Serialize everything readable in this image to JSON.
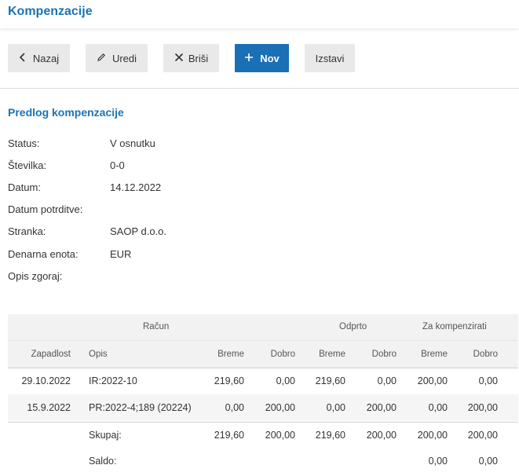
{
  "app": {
    "title": "Kompenzacije"
  },
  "toolbar": {
    "back_label": "Nazaj",
    "edit_label": "Uredi",
    "delete_label": "Briši",
    "new_label": "Nov",
    "issue_label": "Izstavi"
  },
  "section": {
    "title": "Predlog kompenzacije"
  },
  "fields": [
    {
      "label": "Status:",
      "value": "V osnutku"
    },
    {
      "label": "Številka:",
      "value": "0-0"
    },
    {
      "label": "Datum:",
      "value": "14.12.2022"
    },
    {
      "label": "Datum potrditve:",
      "value": ""
    },
    {
      "label": "Stranka:",
      "value": "SAOP d.o.o."
    },
    {
      "label": "Denarna enota:",
      "value": "EUR"
    },
    {
      "label": "Opis zgoraj:",
      "value": ""
    }
  ],
  "table": {
    "group_headers": {
      "racun": "Račun",
      "odprto": "Odprto",
      "za_kompenzirati": "Za kompenzirati"
    },
    "columns": {
      "zapadlost": "Zapadlost",
      "opis": "Opis",
      "breme1": "Breme",
      "dobro1": "Dobro",
      "breme2": "Breme",
      "dobro2": "Dobro",
      "breme3": "Breme",
      "dobro3": "Dobro"
    },
    "rows": [
      {
        "zapadlost": "29.10.2022",
        "opis": "IR:2022-10",
        "racun_breme": "219,60",
        "racun_dobro": "0,00",
        "odprto_breme": "219,60",
        "odprto_dobro": "0,00",
        "komp_breme": "200,00",
        "komp_dobro": "0,00"
      },
      {
        "zapadlost": "15.9.2022",
        "opis": "PR:2022-4;189 (20224)",
        "racun_breme": "0,00",
        "racun_dobro": "200,00",
        "odprto_breme": "0,00",
        "odprto_dobro": "200,00",
        "komp_breme": "0,00",
        "komp_dobro": "200,00"
      }
    ],
    "total": {
      "label": "Skupaj:",
      "racun_breme": "219,60",
      "racun_dobro": "200,00",
      "odprto_breme": "219,60",
      "odprto_dobro": "200,00",
      "komp_breme": "200,00",
      "komp_dobro": "200,00"
    },
    "saldo": {
      "label": "Saldo:",
      "komp_breme": "0,00",
      "komp_dobro": "0,00"
    }
  },
  "icons": {
    "back": "chevron-left-icon",
    "edit": "pencil-icon",
    "delete": "close-icon",
    "new": "plus-icon"
  },
  "colors": {
    "accent": "#1a73b5",
    "primary_button": "#1a6fb5"
  }
}
